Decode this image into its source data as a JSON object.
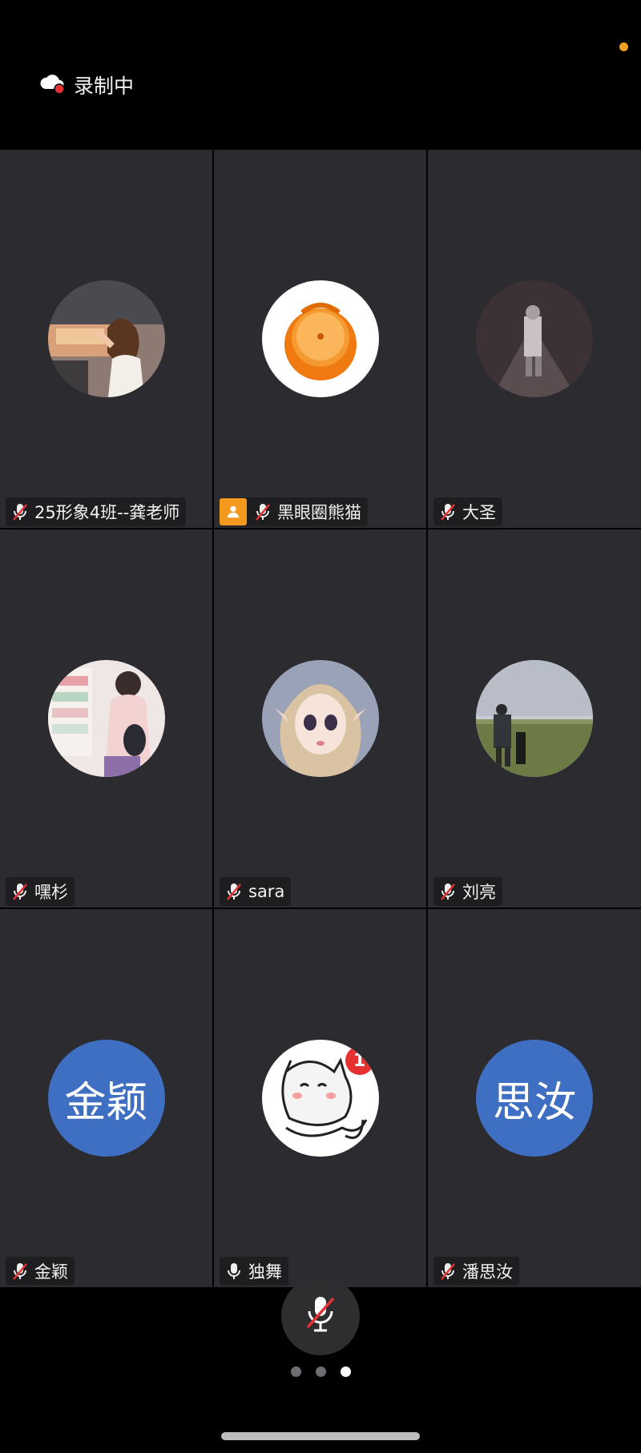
{
  "recording": {
    "label": "录制中",
    "icon": "cloud-record-icon"
  },
  "participants": [
    {
      "name": "25形象4班--龚老师",
      "muted": true,
      "host": false,
      "avatar": "photo-girl-in-car"
    },
    {
      "name": "黑眼圈熊猫",
      "muted": true,
      "host": true,
      "avatar": "orange-fruit"
    },
    {
      "name": "大圣",
      "muted": true,
      "host": false,
      "avatar": "dark-night-photo"
    },
    {
      "name": "嘿杉",
      "muted": true,
      "host": false,
      "avatar": "illustrated-shopper"
    },
    {
      "name": "sara",
      "muted": true,
      "host": false,
      "avatar": "doll-face"
    },
    {
      "name": "刘亮",
      "muted": true,
      "host": false,
      "avatar": "grassland-photo"
    },
    {
      "name": "金颖",
      "muted": true,
      "host": false,
      "avatar_text": "金颖"
    },
    {
      "name": "独舞",
      "muted": false,
      "host": false,
      "avatar": "cartoon-cat",
      "badge": "1"
    },
    {
      "name": "潘思汝",
      "muted": true,
      "host": false,
      "avatar_text": "思汝"
    }
  ],
  "controls": {
    "mute_button": "mic-muted-icon"
  },
  "pager": {
    "pages": 3,
    "active": 3
  },
  "colors": {
    "tile_bg": "#2c2c30",
    "host_badge": "#f39a1e",
    "text_avatar": "#3f6fc2",
    "background": "#000000"
  }
}
